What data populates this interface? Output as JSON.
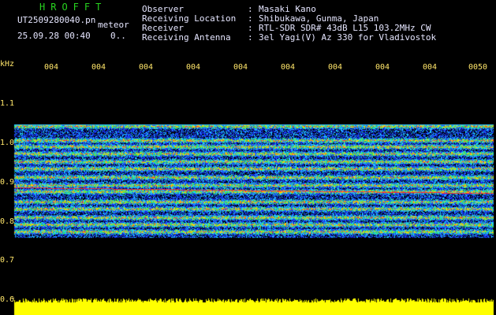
{
  "header": {
    "station_title": "HROFFT",
    "filename": "UT2509280040.pn",
    "meteor_label": "meteor",
    "date_time": "25.09.28 00:40",
    "counter": "0..",
    "fields": [
      {
        "label": "Observer",
        "sep": ":",
        "value": "Masaki Kano"
      },
      {
        "label": "Receiving Location",
        "sep": ":",
        "value": "Shibukawa, Gunma, Japan"
      },
      {
        "label": "Receiver",
        "sep": ":",
        "value": "RTL-SDR SDR# 43dB L15 103.2MHz CW"
      },
      {
        "label": "Receiving Antenna",
        "sep": ":",
        "value": "3el Yagi(V) Az 330 for Vladivostok"
      }
    ]
  },
  "axes": {
    "y_unit": "kHz",
    "y_ticks": [
      "1.1",
      "1.0",
      "0.9",
      "0.8",
      "0.7",
      "0.6"
    ],
    "x_ticks": [
      "004",
      "004",
      "004",
      "004",
      "004",
      "004",
      "004",
      "004",
      "004",
      "0050"
    ]
  },
  "colors": {
    "background": "#000000",
    "text": "#e6e6ff",
    "axis_text": "#ffe66a",
    "title_green": "#27d21f",
    "noise_floor": "#ffff00"
  }
}
